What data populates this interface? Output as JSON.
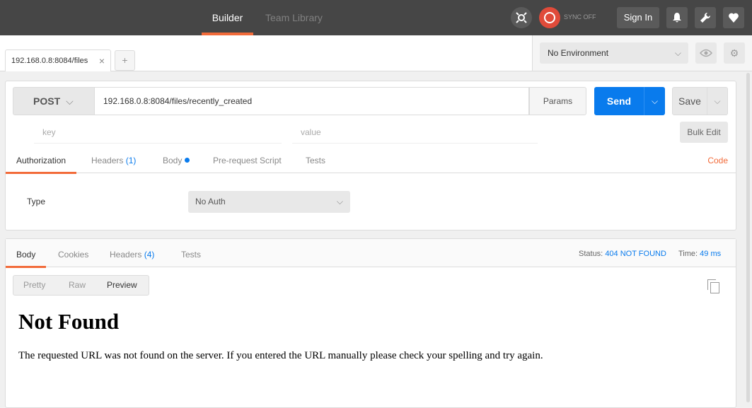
{
  "topbar": {
    "tabs": [
      {
        "label": "Builder",
        "active": true
      },
      {
        "label": "Team Library",
        "active": false
      }
    ],
    "sync_label": "SYNC OFF",
    "signin_label": "Sign In",
    "icons": [
      "interceptor-icon",
      "sync-icon",
      "bell-icon",
      "wrench-icon",
      "heart-icon"
    ]
  },
  "request_tabs": [
    {
      "label": "192.168.0.8:8084/files",
      "close": "×"
    }
  ],
  "new_tab_label": "+",
  "environment": {
    "selected": "No Environment"
  },
  "request": {
    "method": "POST",
    "url": "192.168.0.8:8084/files/recently_created",
    "params_label": "Params",
    "send_label": "Send",
    "save_label": "Save",
    "key_placeholder": "key",
    "value_placeholder": "value",
    "bulk_edit_label": "Bulk Edit"
  },
  "request_subtabs": {
    "authorization": "Authorization",
    "headers": "Headers",
    "headers_count": "(1)",
    "body": "Body",
    "prerequest": "Pre-request Script",
    "tests": "Tests",
    "code": "Code"
  },
  "auth": {
    "type_label": "Type",
    "selected": "No Auth"
  },
  "response": {
    "tabs": {
      "body": "Body",
      "cookies": "Cookies",
      "headers": "Headers",
      "headers_count": "(4)",
      "tests": "Tests"
    },
    "status_label": "Status:",
    "status_value": "404 NOT FOUND",
    "time_label": "Time:",
    "time_value": "49 ms",
    "view_modes": {
      "pretty": "Pretty",
      "raw": "Raw",
      "preview": "Preview"
    },
    "title": "Not Found",
    "message": "The requested URL was not found on the server. If you entered the URL manually please check your spelling and try again."
  },
  "colors": {
    "accent": "#f26b3a",
    "send": "#097bed",
    "topbar": "#464646"
  }
}
